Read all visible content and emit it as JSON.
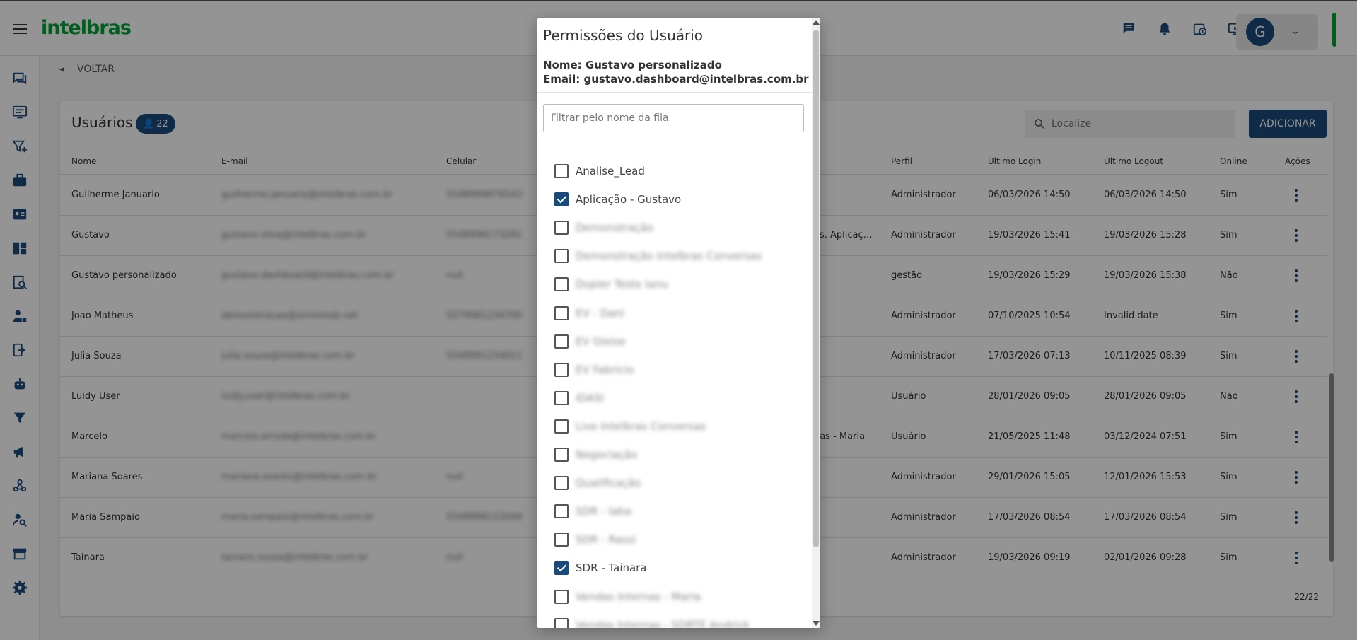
{
  "header": {
    "logo": "intelbras",
    "user_initial": "G",
    "icons": [
      "chat-icon",
      "bell-icon",
      "calendar-clock-icon",
      "screen-icon"
    ]
  },
  "sidebar": {
    "icons": [
      "chats-icon",
      "monitor-icon",
      "filter-plus-icon",
      "briefcase-icon",
      "contact-card-icon",
      "dashboard-icon",
      "report-search-icon",
      "user-lock-icon",
      "device-icon",
      "robot-icon",
      "filter-icon",
      "megaphone-icon",
      "webhook-icon",
      "user-search-icon",
      "store-icon",
      "settings-icon"
    ]
  },
  "back_label": "VOLTAR",
  "users": {
    "title": "Usuários",
    "count": "22",
    "search_placeholder": "Localize",
    "add_label": "ADICIONAR",
    "columns": [
      "Nome",
      "E-mail",
      "Celular",
      "Perfil",
      "Último Login",
      "Último Logout",
      "Online",
      "Ações"
    ],
    "rows": [
      {
        "nome": "Guilherme Januario",
        "email": "guilherme.januario@intelbras.com.br",
        "celular": "5548999876543",
        "extra": "",
        "perfil": "Administrador",
        "login": "06/03/2026 14:50",
        "logout": "06/03/2026 14:50",
        "online": "Sim"
      },
      {
        "nome": "Gustavo",
        "email": "gustavo.silva@intelbras.com.br",
        "celular": "5548996173281",
        "extra": "as, Aplicaç…",
        "perfil": "Administrador",
        "login": "19/03/2026 15:41",
        "logout": "19/03/2026 15:28",
        "online": "Sim"
      },
      {
        "nome": "Gustavo personalizado",
        "email": "gustavo.dashboard@intelbras.com.br",
        "celular": "null",
        "extra": "",
        "perfil": "gestão",
        "login": "19/03/2026 15:29",
        "logout": "19/03/2026 15:38",
        "online": "Não"
      },
      {
        "nome": "Joao Matheus",
        "email": "demonstracao@omnimob.net",
        "celular": "5579981234700",
        "extra": "",
        "perfil": "Administrador",
        "login": "07/10/2025 10:54",
        "logout": "Invalid date",
        "online": "Sim"
      },
      {
        "nome": "Julia Souza",
        "email": "julia.souza@intelbras.com.br",
        "celular": "5548991234011",
        "extra": "",
        "perfil": "Administrador",
        "login": "17/03/2026 07:13",
        "logout": "10/11/2025 08:39",
        "online": "Sim"
      },
      {
        "nome": "Luidy User",
        "email": "luidy.user@intelbras.com.br",
        "celular": "",
        "extra": "",
        "perfil": "Usuário",
        "login": "28/01/2026 09:05",
        "logout": "28/01/2026 09:05",
        "online": "Não"
      },
      {
        "nome": "Marcelo",
        "email": "marcelo.arruda@intelbras.com.br",
        "celular": "",
        "extra": "nas - Maria",
        "perfil": "Usuário",
        "login": "21/05/2025 11:48",
        "logout": "03/12/2024 07:51",
        "online": "Sim"
      },
      {
        "nome": "Mariana Soares",
        "email": "mariana.soares@intelbras.com.br",
        "celular": "null",
        "extra": "",
        "perfil": "Administrador",
        "login": "29/01/2026 15:05",
        "logout": "12/01/2026 15:53",
        "online": "Sim"
      },
      {
        "nome": "Maria Sampaio",
        "email": "maria.sampaio@intelbras.com.br",
        "celular": "5548998122049",
        "extra": "",
        "perfil": "Administrador",
        "login": "17/03/2026 08:54",
        "logout": "17/03/2026 08:54",
        "online": "Sim"
      },
      {
        "nome": "Tainara",
        "email": "tainara.souza@intelbras.com.br",
        "celular": "null",
        "extra": "",
        "perfil": "Administrador",
        "login": "19/03/2026 09:19",
        "logout": "02/01/2026 09:28",
        "online": "Sim"
      }
    ],
    "pager": "22/22"
  },
  "dialog": {
    "title": "Permissões do Usuário",
    "name_line": "Nome: Gustavo personalizado",
    "email_line": "Email: gustavo.dashboard@intelbras.com.br",
    "filter_placeholder": "Filtrar pelo nome da fila",
    "queues": [
      {
        "label": "Analise_Lead",
        "checked": false,
        "blurred": false
      },
      {
        "label": "Aplicação - Gustavo",
        "checked": true,
        "blurred": false
      },
      {
        "label": "Demonstração",
        "checked": false,
        "blurred": true
      },
      {
        "label": "Demonstração Intelbras Conversas",
        "checked": false,
        "blurred": true
      },
      {
        "label": "Dopler Teste Ianu",
        "checked": false,
        "blurred": true
      },
      {
        "label": "EV - Dani",
        "checked": false,
        "blurred": true
      },
      {
        "label": "EV Gleise",
        "checked": false,
        "blurred": true
      },
      {
        "label": "EV Fabricio",
        "checked": false,
        "blurred": true
      },
      {
        "label": "IDASI",
        "checked": false,
        "blurred": true
      },
      {
        "label": "Live Intelbras Conversas",
        "checked": false,
        "blurred": true
      },
      {
        "label": "Negociação",
        "checked": false,
        "blurred": true
      },
      {
        "label": "Qualificação",
        "checked": false,
        "blurred": true
      },
      {
        "label": "SDR - Iaba",
        "checked": false,
        "blurred": true
      },
      {
        "label": "SDR - Rassi",
        "checked": false,
        "blurred": true
      },
      {
        "label": "SDR - Tainara",
        "checked": true,
        "blurred": false
      },
      {
        "label": "Vendas Internas - Maria",
        "checked": false,
        "blurred": true
      },
      {
        "label": "Vendas Internas - SDRTE Andrick",
        "checked": false,
        "blurred": true
      }
    ]
  },
  "colors": {
    "brand_green": "#00a335",
    "primary_blue": "#1a4a7a"
  }
}
